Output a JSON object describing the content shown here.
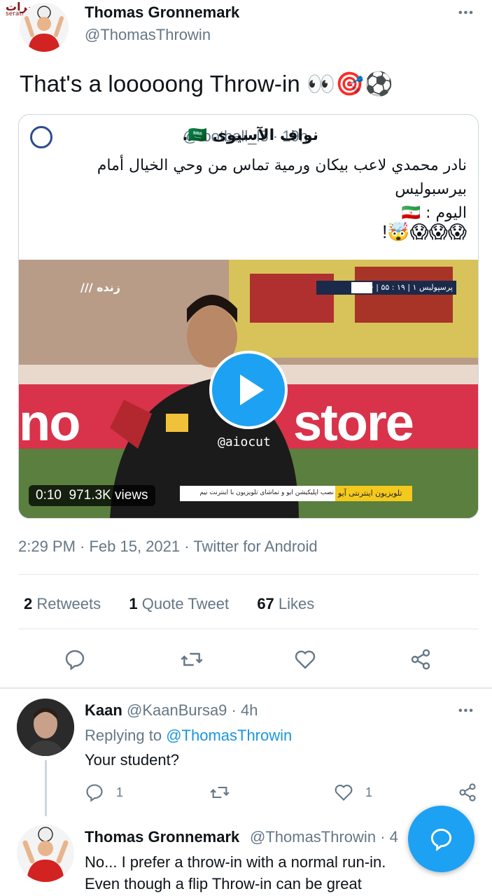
{
  "watermark": "seratnews.ir",
  "tweet": {
    "author_name": "Thomas Gronnemark",
    "author_handle": "@ThomasThrowin",
    "text": "That's a looooong Throw-in 👀🎯⚽",
    "timestamp": "2:29 PM · Feb 15, 2021",
    "client": "Twitter for Android",
    "retweets_count": "2",
    "retweets_label": "Retweets",
    "quotes_count": "1",
    "quotes_label": "Quote Tweet",
    "likes_count": "67",
    "likes_label": "Likes"
  },
  "quoted": {
    "author_name": "نواف الآسيوى 🇸🇦.",
    "author_handle": "@football_l5",
    "age": "· 19h",
    "text_line1": "نادر محمدي لاعب بيكان ورمية تماس من وحي الخيال أمام بيرسبوليس",
    "text_line2": "اليوم : 🇮🇷",
    "emoji_line": "!🤯😱😱😱",
    "video": {
      "live_label": "زنده",
      "scoreboard": "پرسپولیس ۱ | ۱۹ : ۵۵ | · پیکان",
      "watermark": "@aiocut",
      "ad_banner_left": "تلویزیون اینترنتی آیو",
      "ad_banner_right": "نصب اپلیکیشن آیو و تماشای تلویزیون با اینترنت نیم",
      "banner_text": "store",
      "banner_text_left": "no",
      "duration": "0:10",
      "views": "971.3K views"
    }
  },
  "reply1": {
    "author_name": "Kaan",
    "author_handle": "@KaanBursa9",
    "age": "· 4h",
    "replying_prefix": "Replying to",
    "replying_handle": "@ThomasThrowin",
    "text": "Your student?",
    "reply_count": "1",
    "like_count": "1"
  },
  "reply2": {
    "author_name": "Thomas Gronnemark",
    "author_handle": "@ThomasThrowin",
    "age": "· 4",
    "text": "No... I prefer a throw-in with a normal run-in. Even though a flip Throw-in can be great"
  },
  "colors": {
    "accent": "#1da1f2",
    "muted": "#657786",
    "divider": "#e1e8ed"
  }
}
